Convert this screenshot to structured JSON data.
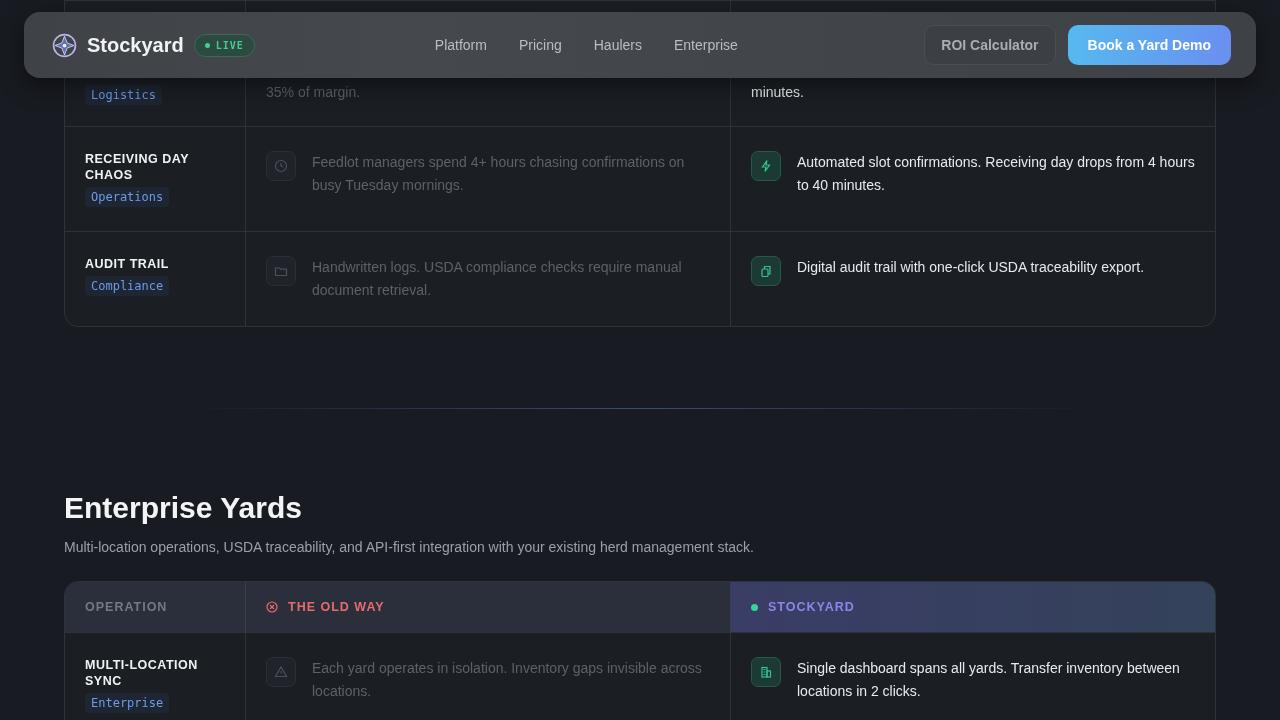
{
  "nav": {
    "brand": "Stockyard",
    "badge": "LIVE",
    "links": [
      "Platform",
      "Pricing",
      "Haulers",
      "Enterprise"
    ],
    "secondary_button": "ROI Calculator",
    "primary_button": "Book a Yard Demo"
  },
  "top_table": {
    "rows": [
      {
        "tag": "Logistics",
        "old_text": "35% of margin.",
        "new_text": "minutes."
      },
      {
        "title": "RECEIVING DAY CHAOS",
        "tag": "Operations",
        "old_text": "Feedlot managers spend 4+ hours chasing confirmations on busy Tuesday mornings.",
        "new_text": "Automated slot confirmations. Receiving day drops from 4 hours to 40 minutes."
      },
      {
        "title": "AUDIT TRAIL",
        "tag": "Compliance",
        "old_text": "Handwritten logs. USDA compliance checks require manual document retrieval.",
        "new_text": "Digital audit trail with one-click USDA traceability export."
      }
    ]
  },
  "section": {
    "heading": "Enterprise Yards",
    "subtitle": "Multi-location operations, USDA traceability, and API-first integration with your existing herd management stack.",
    "table": {
      "columns": [
        {
          "label": "OPERATION",
          "kind": "plain"
        },
        {
          "label": "THE OLD WAY",
          "kind": "old"
        },
        {
          "label": "STOCKYARD",
          "kind": "new"
        }
      ],
      "rows": [
        {
          "title": "MULTI-LOCATION SYNC",
          "tag": "Enterprise",
          "old_text": "Each yard operates in isolation. Inventory gaps invisible across locations.",
          "new_text": "Single dashboard spans all yards. Transfer inventory between locations in 2 clicks."
        }
      ]
    }
  }
}
